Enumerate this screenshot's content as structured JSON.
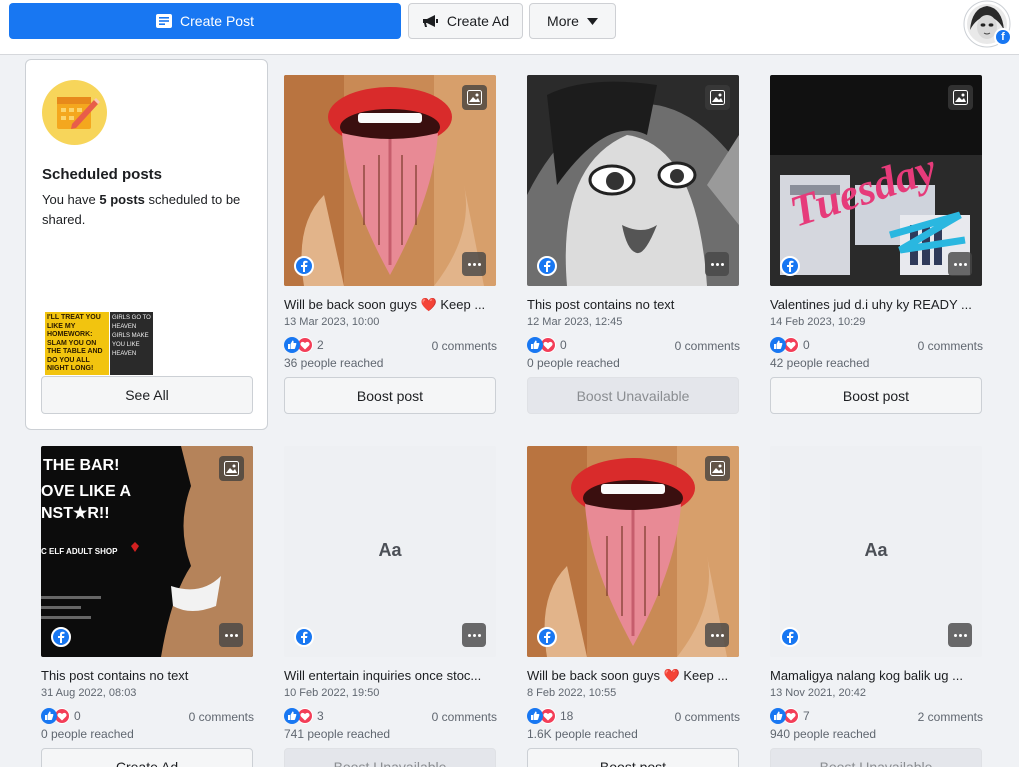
{
  "toolbar": {
    "create_post": "Create Post",
    "create_ad": "Create Ad",
    "more": "More"
  },
  "scheduled": {
    "title": "Scheduled posts",
    "desc_pre": "You have ",
    "desc_bold": "5 posts",
    "desc_post": " scheduled to be shared.",
    "thumb1_text": "I'LL TREAT YOU LIKE MY HOMEWORK: SLAM YOU ON THE TABLE AND DO YOU ALL NIGHT LONG!",
    "thumb2_text": "GIRLS GO TO HEAVEN GIRLS MAKE YOU LIKE HEAVEN",
    "see_all": "See All"
  },
  "posts": [
    {
      "text": "Will be back soon guys ❤️ Keep ...",
      "date": "13 Mar 2023, 10:00",
      "reactions": "2",
      "comments": "0 comments",
      "reached": "36 people reached",
      "button": "Boost post",
      "kind": "image",
      "art": "lips"
    },
    {
      "text": "This post contains no text",
      "date": "12 Mar 2023, 12:45",
      "reactions": "0",
      "comments": "0 comments",
      "reached": "0 people reached",
      "button": "Boost Unavailable",
      "kind": "image",
      "art": "girl"
    },
    {
      "text": "Valentines jud d.i uhy ky READY ...",
      "date": "14 Feb 2023, 10:29",
      "reactions": "0",
      "comments": "0 comments",
      "reached": "42 people reached",
      "button": "Boost post",
      "kind": "image",
      "art": "tuesday",
      "art_text": "Tuesday"
    },
    {
      "text": "This post contains no text",
      "date": "31 Aug 2022, 08:03",
      "reactions": "0",
      "comments": "0 comments",
      "reached": "0 people reached",
      "button": "Create Ad",
      "kind": "image",
      "art": "poster",
      "art_lines": [
        "THE BAR!",
        "OVE LIKE A",
        "NST★R!!",
        "C ELF ADULT SHOP"
      ]
    },
    {
      "text": "Will entertain inquiries once stoc...",
      "date": "10 Feb 2022, 19:50",
      "reactions": "3",
      "comments": "0 comments",
      "reached": "741 people reached",
      "button": "Boost Unavailable",
      "kind": "text",
      "placeholder": "Aa"
    },
    {
      "text": "Will be back soon guys ❤️ Keep ...",
      "date": "8 Feb 2022, 10:55",
      "reactions": "18",
      "comments": "0 comments",
      "reached": "1.6K people reached",
      "button": "Boost post",
      "kind": "image",
      "art": "lips"
    },
    {
      "text": "Mamaligya nalang kog balik ug ...",
      "date": "13 Nov 2021, 20:42",
      "reactions": "7",
      "comments": "2 comments",
      "reached": "940 people reached",
      "button": "Boost Unavailable",
      "kind": "text",
      "placeholder": "Aa"
    }
  ]
}
